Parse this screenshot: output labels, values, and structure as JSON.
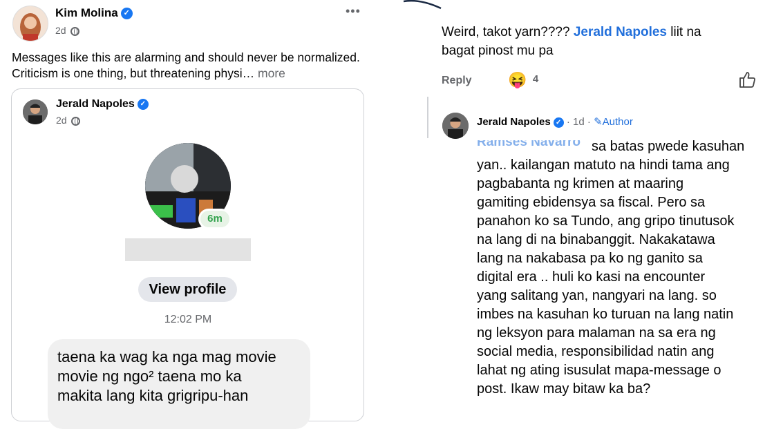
{
  "left_post": {
    "author": "Kim Molina",
    "time": "2d",
    "text": "Messages like this are alarming and should never be normalized. Criticism is one thing, but threatening physi…",
    "more_label": "more",
    "menu": "•••"
  },
  "shared_post": {
    "author": "Jerald Napoles",
    "time": "2d",
    "story_badge": "6m",
    "view_profile": "View profile",
    "timestamp": "12:02 PM",
    "message_lines": [
      "taena ka wag ka nga mag movie",
      "movie ng ngo² taena mo ka",
      "makita lang kita grigripu-han"
    ]
  },
  "right_comment": {
    "line1_prefix": "Weird, takot yarn???? ",
    "line1_mention": "Jerald Napoles",
    "line1_suffix": " liit na",
    "line2": "bagat pinost mu pa",
    "reply_label": "Reply",
    "reaction_emoji": "😝",
    "reaction_count": "4"
  },
  "reply": {
    "author": "Jerald Napoles",
    "time": "· 1d ·",
    "author_badge": "Author",
    "lines": [
      "sa batas pwede kasuhan",
      "yan.. kailangan matuto na hindi tama ang",
      "pagbabanta ng krimen at maaring",
      "gamiting ebidensya sa fiscal. Pero sa",
      "panahon ko sa Tundo, ang gripo tinutusok",
      "na lang di na binabanggit. Nakakatawa",
      "lang na nakabasa pa ko ng ganito sa",
      "digital era .. huli ko kasi na encounter",
      "yang salitang yan, nangyari na lang. so",
      "imbes na kasuhan ko turuan na lang natin",
      "ng leksyon para malaman na sa era ng",
      "social media, responsibilidad natin ang",
      "lahat ng ating isusulat mapa-message o",
      "post. Ikaw may bitaw ka ba?"
    ]
  },
  "colors": {
    "verified": "#1877f2",
    "mention": "#216fdb",
    "story_ring": "#31a24c",
    "muted": "#65676b"
  }
}
